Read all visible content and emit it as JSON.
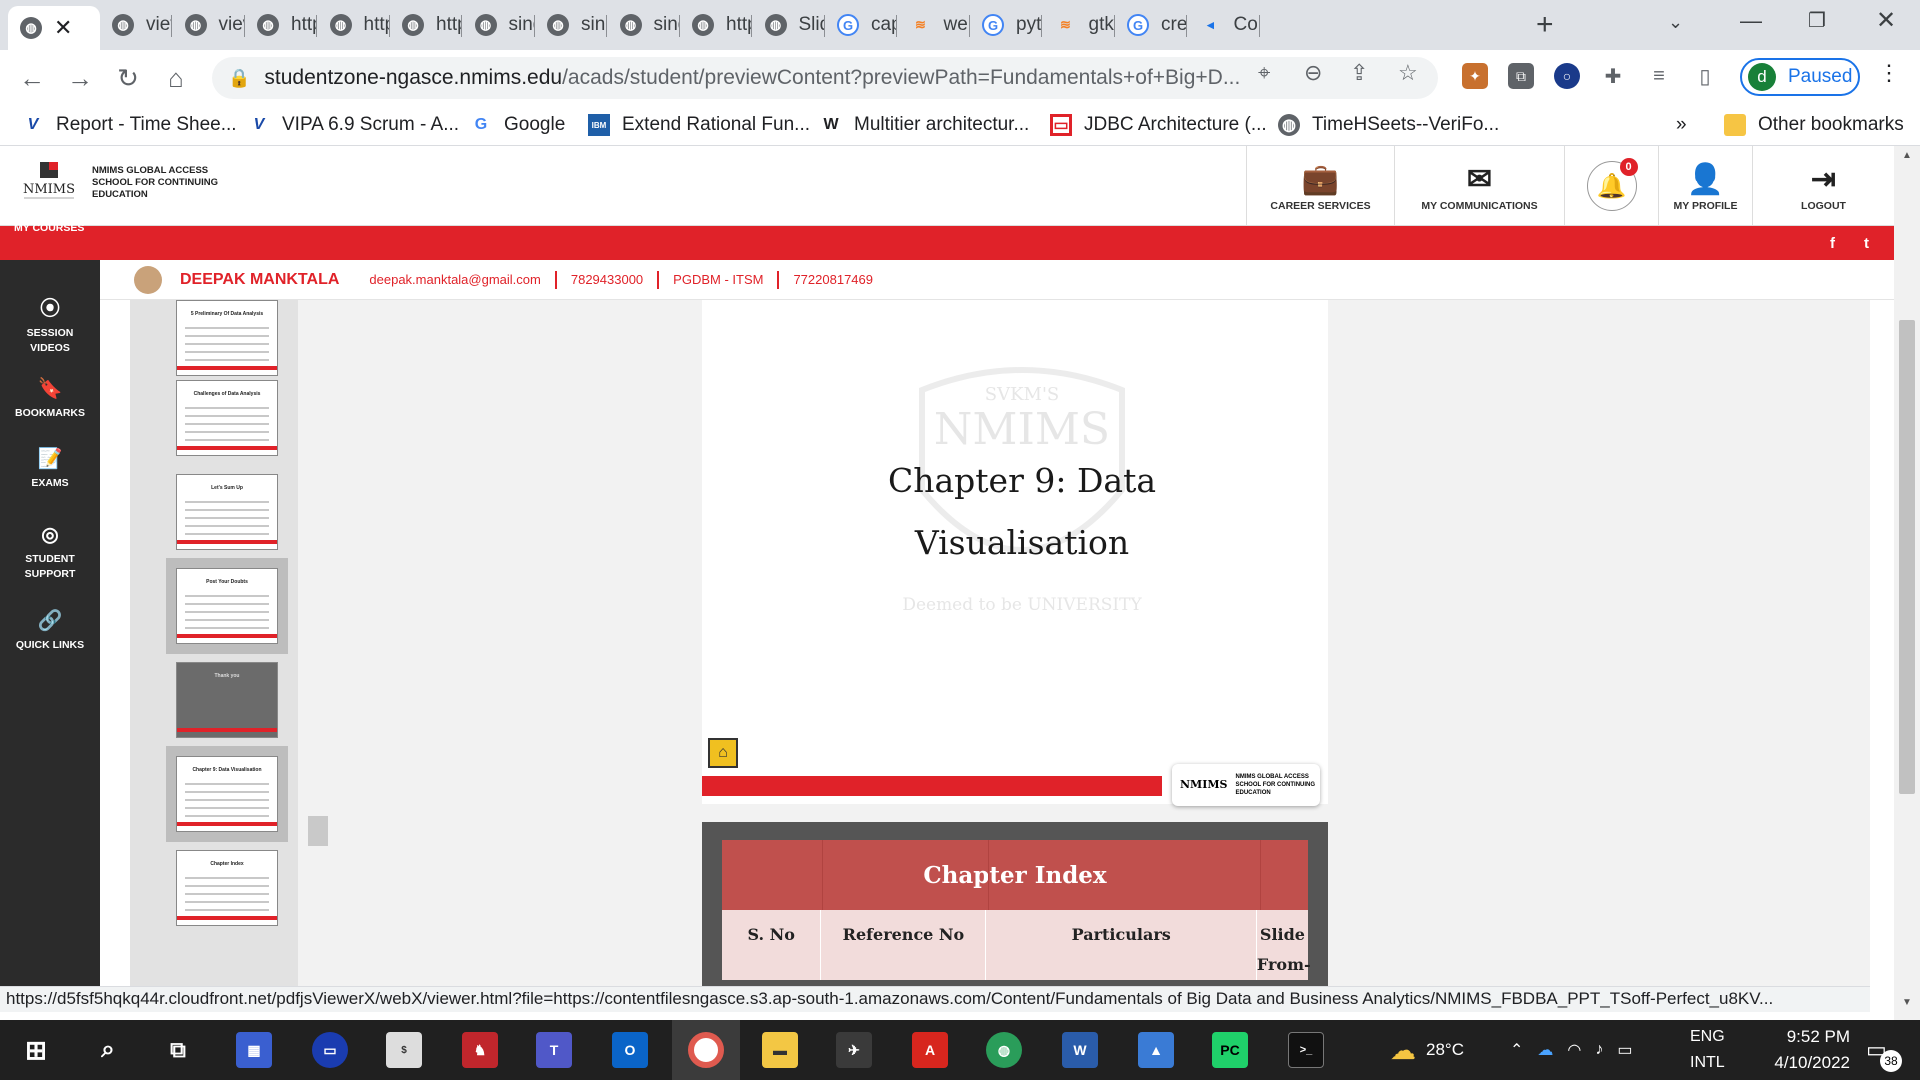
{
  "browser": {
    "tabs": [
      {
        "icon": "globe-icon",
        "label": ""
      },
      {
        "icon": "globe-icon",
        "label": "viev"
      },
      {
        "icon": "globe-icon",
        "label": "viev"
      },
      {
        "icon": "globe-icon",
        "label": "http"
      },
      {
        "icon": "globe-icon",
        "label": "http"
      },
      {
        "icon": "globe-icon",
        "label": "http"
      },
      {
        "icon": "globe-icon",
        "label": "sing"
      },
      {
        "icon": "globe-icon",
        "label": "sing"
      },
      {
        "icon": "globe-icon",
        "label": "sing"
      },
      {
        "icon": "globe-icon",
        "label": "http"
      },
      {
        "icon": "globe-icon",
        "label": "Slid"
      },
      {
        "icon": "google-icon",
        "label": "cap"
      },
      {
        "icon": "stackoverflow-icon",
        "label": "wel"
      },
      {
        "icon": "google-icon",
        "label": "pytl"
      },
      {
        "icon": "stackoverflow-icon",
        "label": "gtk"
      },
      {
        "icon": "google-icon",
        "label": "crea"
      },
      {
        "icon": "fish-icon",
        "label": "Cor"
      }
    ],
    "url_host": "studentzone-ngasce.nmims.edu",
    "url_path": "/acads/student/previewContent?previewPath=Fundamentals+of+Big+D...",
    "profile_letter": "d",
    "profile_status": "Paused",
    "bookmarks": [
      {
        "icon": "v-icon",
        "label": "Report - Time Shee..."
      },
      {
        "icon": "v-icon",
        "label": "VIPA 6.9 Scrum - A..."
      },
      {
        "icon": "google-icon",
        "label": "Google"
      },
      {
        "icon": "ibm-icon",
        "label": "Extend Rational Fun..."
      },
      {
        "icon": "wikipedia-icon",
        "label": "Multitier architectur..."
      },
      {
        "icon": "jdbc-icon",
        "label": "JDBC Architecture (..."
      },
      {
        "icon": "globe-icon",
        "label": "TimeHSeets--VeriFo..."
      }
    ],
    "bookmarks_more": "»",
    "other_bookmarks": "Other bookmarks",
    "status_url": "https://d5fsf5hqkq44r.cloudfront.net/pdfjsViewerX/webX/viewer.html?file=https://contentfilesngasce.s3.ap-south-1.amazonaws.com/Content/Fundamentals of Big Data and Business Analytics/NMIMS_FBDBA_PPT_TSoff-Perfect_u8KV..."
  },
  "site": {
    "logo_text": "NMIMS GLOBAL ACCESS SCHOOL FOR CONTINUING EDUCATION",
    "logo_mark": "NMIMS",
    "nav": [
      {
        "icon": "briefcase-icon",
        "label": "CAREER SERVICES"
      },
      {
        "icon": "envelope-icon",
        "label": "MY COMMUNICATIONS"
      },
      {
        "icon": "bell-icon",
        "label": "",
        "badge": "0"
      },
      {
        "icon": "user-icon",
        "label": "MY PROFILE"
      },
      {
        "icon": "logout-icon",
        "label": "LOGOUT"
      }
    ],
    "my_courses": "MY COURSES",
    "social": [
      "f",
      "t"
    ],
    "sidebar": [
      {
        "icon": "play-circle-icon",
        "label": "SESSION VIDEOS"
      },
      {
        "icon": "bookmark-icon",
        "label": "BOOKMARKS"
      },
      {
        "icon": "exam-icon",
        "label": "EXAMS"
      },
      {
        "icon": "lifebuoy-icon",
        "label": "STUDENT SUPPORT"
      },
      {
        "icon": "link-icon",
        "label": "QUICK LINKS"
      }
    ],
    "user": {
      "name": "DEEPAK MANKTALA",
      "email": "deepak.manktala@gmail.com",
      "phone": "7829433000",
      "program": "PGDBM - ITSM",
      "id": "77220817469"
    }
  },
  "viewer": {
    "thumbnails": [
      {
        "title": "5 Preliminary Of Data Analysis",
        "selected": false,
        "dark": false
      },
      {
        "title": "Challenges of Data Analysis",
        "selected": false,
        "dark": false
      },
      {
        "title": "Let's Sum Up",
        "selected": false,
        "dark": false
      },
      {
        "title": "Post Your Doubts",
        "selected": true,
        "dark": false
      },
      {
        "title": "Thank you",
        "selected": false,
        "dark": true
      },
      {
        "title": "Chapter 9: Data Visualisation",
        "selected": true,
        "dark": false
      },
      {
        "title": "Chapter Index",
        "selected": false,
        "dark": false
      }
    ],
    "slide_title_line1": "Chapter 9: Data",
    "slide_title_line2": "Visualisation",
    "watermark_top": "SVKM'S",
    "watermark_main": "NMIMS",
    "watermark_bottom": "Deemed to be UNIVERSITY",
    "slide_logo_text": "NMIMS GLOBAL ACCESS SCHOOL FOR CONTINUING EDUCATION",
    "chapter_index": {
      "title": "Chapter Index",
      "columns": [
        "S. No",
        "Reference No",
        "Particulars",
        "Slide From-To"
      ]
    }
  },
  "taskbar": {
    "weather": "28°C",
    "lang1": "ENG",
    "lang2": "INTL",
    "time": "9:52 PM",
    "date": "4/10/2022",
    "notifications": "38"
  }
}
